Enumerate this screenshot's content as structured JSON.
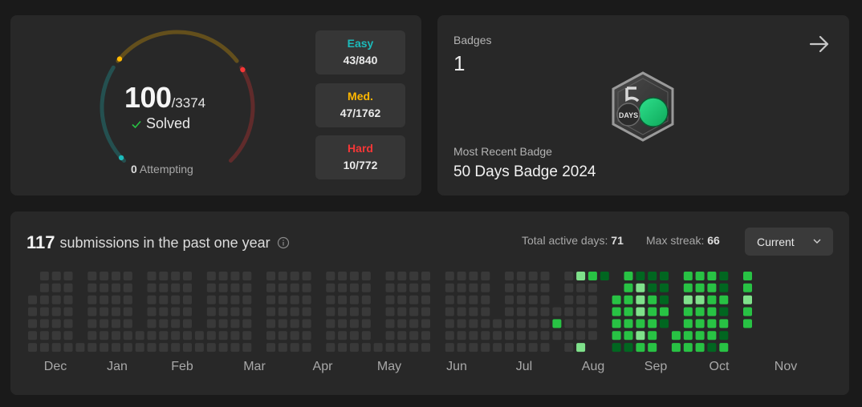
{
  "progress": {
    "solved": "100",
    "total": "/3374",
    "solved_label": "Solved",
    "attempting_count": "0",
    "attempting_label": "Attempting",
    "ring_colors": {
      "easy": "#1cbaba",
      "medium": "#ffb700",
      "hard": "#f63737"
    },
    "difficulties": [
      {
        "name": "Easy",
        "value": "43/840",
        "color": "#1cbaba"
      },
      {
        "name": "Med.",
        "value": "47/1762",
        "color": "#ffb700"
      },
      {
        "name": "Hard",
        "value": "10/772",
        "color": "#f63737"
      }
    ],
    "icons": {
      "solved": "check-icon"
    }
  },
  "badges": {
    "label": "Badges",
    "count": "1",
    "recent_label": "Most Recent Badge",
    "recent_name": "50 Days Badge 2024",
    "badge_text": "DAYS",
    "icons": {
      "navigate": "arrow-right-icon",
      "badge": "50-days-badge-icon"
    }
  },
  "calendar": {
    "count": "117",
    "text": "submissions in the past one year",
    "active_label": "Total active days:",
    "active_value": "71",
    "streak_label": "Max streak:",
    "streak_value": "66",
    "selector": "Current",
    "months": [
      "Dec",
      "Jan",
      "Feb",
      "Mar",
      "Apr",
      "May",
      "Jun",
      "Jul",
      "Aug",
      "Sep",
      "Oct",
      "Nov"
    ],
    "level_colors": [
      "#393939",
      "#016620",
      "#28c244",
      "#7fe18b"
    ],
    "weeks": [
      [
        -1,
        -1,
        0,
        0,
        0,
        0,
        0
      ],
      [
        0,
        0,
        0,
        0,
        0,
        0,
        0
      ],
      [
        0,
        0,
        0,
        0,
        0,
        0,
        0
      ],
      [
        0,
        0,
        0,
        0,
        0,
        0,
        0
      ],
      [
        -1,
        -1,
        -1,
        -1,
        -1,
        -1,
        0
      ],
      [
        0,
        0,
        0,
        0,
        0,
        0,
        0
      ],
      [
        0,
        0,
        0,
        0,
        0,
        0,
        0
      ],
      [
        0,
        0,
        0,
        0,
        0,
        0,
        0
      ],
      [
        0,
        0,
        0,
        0,
        0,
        0,
        0
      ],
      [
        -1,
        -1,
        -1,
        -1,
        -1,
        0,
        0
      ],
      [
        0,
        0,
        0,
        0,
        0,
        0,
        0
      ],
      [
        0,
        0,
        0,
        0,
        0,
        0,
        0
      ],
      [
        0,
        0,
        0,
        0,
        0,
        0,
        0
      ],
      [
        0,
        0,
        0,
        0,
        0,
        0,
        0
      ],
      [
        -1,
        -1,
        -1,
        -1,
        -1,
        0,
        0
      ],
      [
        0,
        0,
        0,
        0,
        0,
        0,
        0
      ],
      [
        0,
        0,
        0,
        0,
        0,
        0,
        0
      ],
      [
        0,
        0,
        0,
        0,
        0,
        0,
        0
      ],
      [
        0,
        0,
        0,
        0,
        0,
        0,
        0
      ],
      [
        -1,
        -1,
        -1,
        -1,
        -1,
        -1,
        -1
      ],
      [
        0,
        0,
        0,
        0,
        0,
        0,
        0
      ],
      [
        0,
        0,
        0,
        0,
        0,
        0,
        0
      ],
      [
        0,
        0,
        0,
        0,
        0,
        0,
        0
      ],
      [
        0,
        0,
        0,
        0,
        0,
        0,
        0
      ],
      [
        -1,
        -1,
        -1,
        -1,
        -1,
        -1,
        -1
      ],
      [
        0,
        0,
        0,
        0,
        0,
        0,
        0
      ],
      [
        0,
        0,
        0,
        0,
        0,
        0,
        0
      ],
      [
        0,
        0,
        0,
        0,
        0,
        0,
        0
      ],
      [
        0,
        0,
        0,
        0,
        0,
        0,
        0
      ],
      [
        -1,
        -1,
        -1,
        -1,
        -1,
        -1,
        0
      ],
      [
        0,
        0,
        0,
        0,
        0,
        0,
        0
      ],
      [
        0,
        0,
        0,
        0,
        0,
        0,
        0
      ],
      [
        0,
        0,
        0,
        0,
        0,
        0,
        0
      ],
      [
        0,
        0,
        0,
        0,
        0,
        0,
        0
      ],
      [
        -1,
        -1,
        -1,
        -1,
        -1,
        -1,
        -1
      ],
      [
        0,
        0,
        0,
        0,
        0,
        0,
        0
      ],
      [
        0,
        0,
        0,
        0,
        0,
        0,
        0
      ],
      [
        0,
        0,
        0,
        0,
        0,
        0,
        0
      ],
      [
        0,
        0,
        0,
        0,
        0,
        0,
        0
      ],
      [
        -1,
        -1,
        -1,
        -1,
        0,
        0,
        0
      ],
      [
        0,
        0,
        0,
        0,
        0,
        0,
        0
      ],
      [
        0,
        0,
        0,
        0,
        0,
        0,
        0
      ],
      [
        0,
        0,
        0,
        0,
        0,
        0,
        0
      ],
      [
        0,
        0,
        0,
        0,
        0,
        0,
        0
      ],
      [
        -1,
        -1,
        -1,
        0,
        2,
        0,
        -1
      ],
      [
        0,
        0,
        0,
        0,
        0,
        0,
        0
      ],
      [
        3,
        0,
        0,
        0,
        0,
        0,
        3
      ],
      [
        2,
        0,
        0,
        0,
        0,
        0,
        -1
      ],
      [
        1,
        -1,
        -1,
        -1,
        -1,
        -1,
        -1
      ],
      [
        -1,
        -1,
        2,
        2,
        2,
        2,
        1
      ],
      [
        2,
        2,
        2,
        2,
        2,
        2,
        1
      ],
      [
        1,
        3,
        3,
        3,
        2,
        3,
        2
      ],
      [
        1,
        1,
        2,
        2,
        2,
        2,
        2
      ],
      [
        1,
        1,
        1,
        2,
        1,
        -1,
        -1
      ],
      [
        -1,
        -1,
        -1,
        -1,
        -1,
        2,
        2
      ],
      [
        2,
        2,
        3,
        2,
        2,
        2,
        2
      ],
      [
        2,
        2,
        3,
        2,
        2,
        2,
        2
      ],
      [
        2,
        2,
        2,
        2,
        2,
        2,
        1
      ],
      [
        1,
        1,
        2,
        1,
        2,
        1,
        2
      ],
      [
        -1,
        -1,
        -1,
        -1,
        -1,
        -1,
        -1
      ],
      [
        2,
        2,
        3,
        2,
        2,
        -1,
        -1
      ]
    ]
  }
}
